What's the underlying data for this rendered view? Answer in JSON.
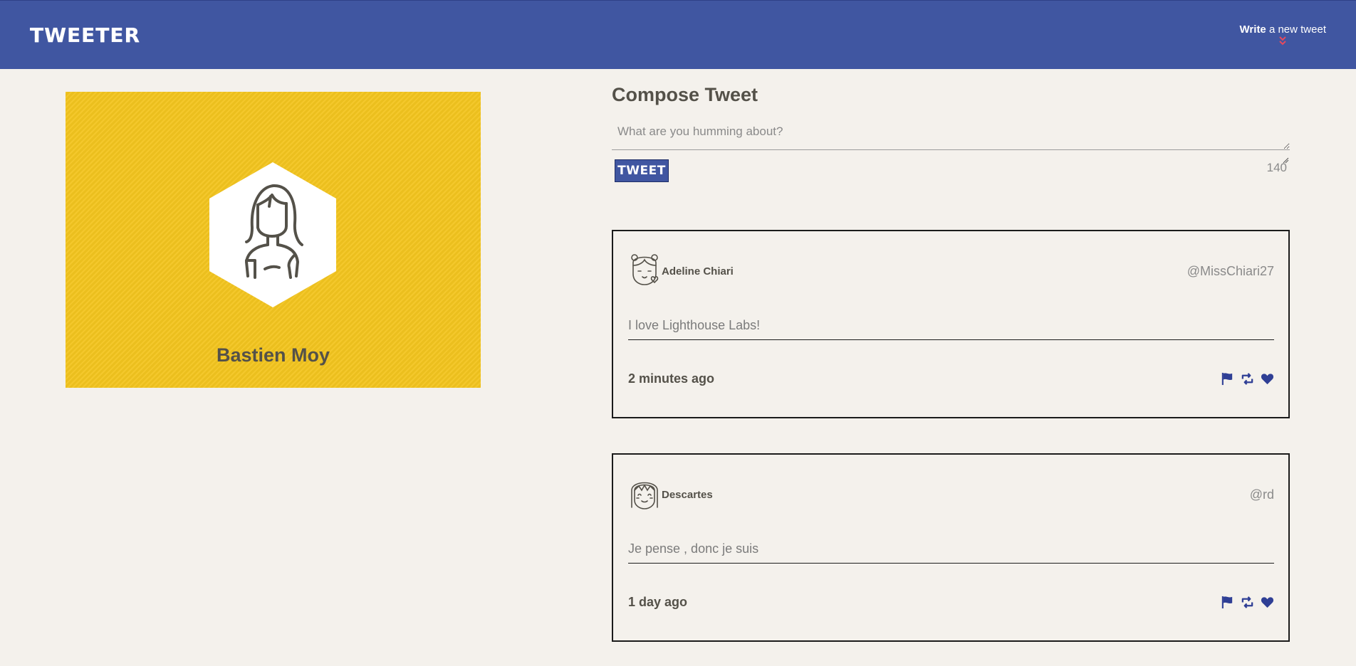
{
  "nav": {
    "brand": "TWEETER",
    "write_strong": "Write",
    "write_rest": " a new tweet",
    "brand_color": "#4056a1",
    "chevron_color": "#e64a5d"
  },
  "profile": {
    "name": "Bastien Moy",
    "card_color": "#f3c51f"
  },
  "compose": {
    "title": "Compose Tweet",
    "placeholder": "What are you humming about?",
    "button_label": "TWEET",
    "counter": "140"
  },
  "tweets": [
    {
      "author": "Adeline Chiari",
      "handle": "@MissChiari27",
      "content": "I love Lighthouse Labs!",
      "time": "2 minutes ago",
      "avatar_icon": "woman-avatar-icon"
    },
    {
      "author": "Descartes",
      "handle": "@rd",
      "content": "Je pense , donc je suis",
      "time": "1 day ago",
      "avatar_icon": "girl-avatar-icon"
    }
  ],
  "actions": {
    "icons": [
      "flag-icon",
      "retweet-icon",
      "heart-icon"
    ],
    "icon_color": "#2f3f95"
  }
}
